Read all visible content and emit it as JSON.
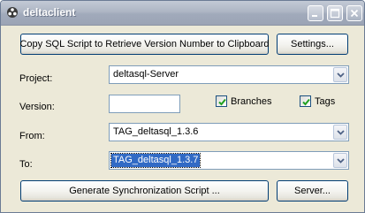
{
  "window": {
    "title": "deltaclient"
  },
  "toolbar": {
    "copy_sql_label": "Copy SQL Script to Retrieve Version Number to Clipboard",
    "settings_label": "Settings..."
  },
  "form": {
    "project_label": "Project:",
    "project_value": "deltasql-Server",
    "version_label": "Version:",
    "version_value": "",
    "branches_label": "Branches",
    "branches_checked": true,
    "tags_label": "Tags",
    "tags_checked": true,
    "from_label": "From:",
    "from_value": "TAG_deltasql_1.3.6",
    "to_label": "To:",
    "to_value": "TAG_deltasql_1.3.7"
  },
  "actions": {
    "generate_label": "Generate Synchronization Script ...",
    "server_label": "Server..."
  }
}
